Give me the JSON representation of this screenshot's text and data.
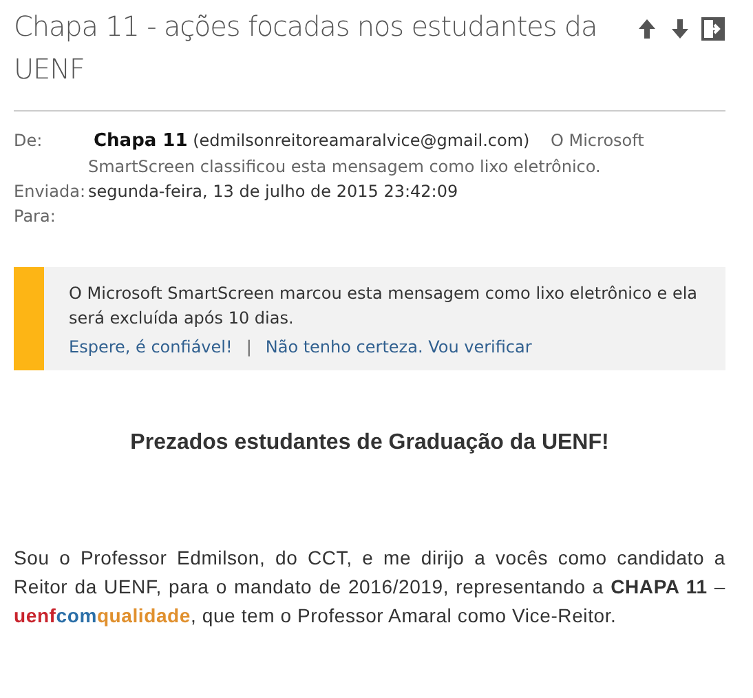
{
  "message": {
    "subject": "Chapa 11 - ações focadas nos estudantes da UENF"
  },
  "toolbar": [
    {
      "kind": "up"
    },
    {
      "kind": "down"
    },
    {
      "kind": "expand"
    }
  ],
  "header": {
    "from_label": "De:",
    "sender_name": "Chapa 11",
    "sender_email": "(edmilsonreitoreamaralvice@gmail.com)",
    "from_note": "O Microsoft SmartScreen classificou esta mensagem como lixo eletrônico.",
    "sent_label": "Enviada:",
    "sent_value": "segunda-feira, 13 de julho de 2015 23:42:09",
    "to_label": "Para:"
  },
  "junk_banner": {
    "text": "O Microsoft SmartScreen marcou esta mensagem como lixo eletrônico e ela será excluída após 10 dias.",
    "links": [
      "Espere, é confiável!",
      "Não tenho certeza. Vou verificar"
    ],
    "separator": "|"
  },
  "body": {
    "heading": "Prezados estudantes de Graduação da UENF!",
    "paragraph": [
      {
        "text": "Sou o Professor Edmilson, do CCT, e me dirijo a vocês como candidato a Reitor da UENF, para o mandato de 2016/2019, representando a ",
        "bold": false
      },
      {
        "text": "CHAPA 11",
        "bold": true
      },
      {
        "text": " – ",
        "bold": false
      },
      {
        "text": "uenf",
        "bold": true,
        "color": "#c8232c"
      },
      {
        "text": "com",
        "bold": true,
        "color": "#2b6fa8"
      },
      {
        "text": "qualidade",
        "bold": true,
        "color": "#e0902e"
      },
      {
        "text": ", que tem o Professor Amaral como Vice-Reitor.",
        "bold": false
      }
    ]
  }
}
